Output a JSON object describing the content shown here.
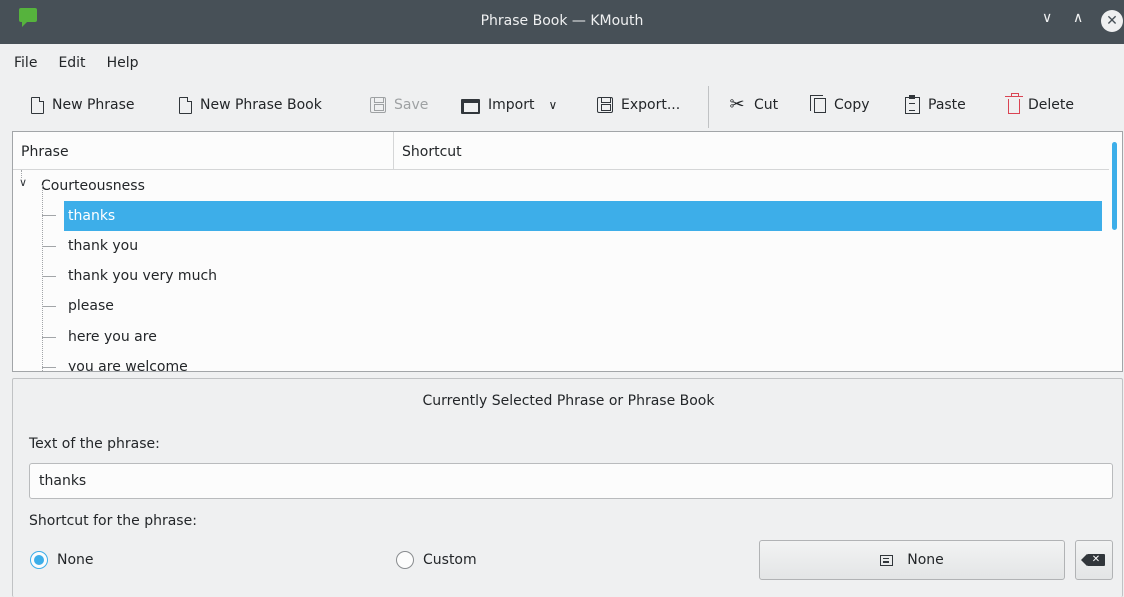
{
  "window": {
    "title": "Phrase Book — KMouth",
    "minimize_glyph": "∨",
    "maximize_glyph": "∧",
    "close_glyph": "✕"
  },
  "menu": [
    {
      "label": "File"
    },
    {
      "label": "Edit"
    },
    {
      "label": "Help"
    }
  ],
  "toolbar": {
    "new_phrase": "New Phrase",
    "new_phrase_book": "New Phrase Book",
    "save": "Save",
    "import": "Import",
    "import_chevron": "∨",
    "export": "Export...",
    "cut": "Cut",
    "cut_glyph": "✂",
    "copy": "Copy",
    "paste": "Paste",
    "delete": "Delete"
  },
  "tree": {
    "columns": [
      "Phrase",
      "Shortcut"
    ],
    "expander_glyph": "∨",
    "root": "Courteousness",
    "items": [
      {
        "phrase": "thanks",
        "shortcut": "",
        "selected": true
      },
      {
        "phrase": "thank you",
        "shortcut": ""
      },
      {
        "phrase": "thank you very much",
        "shortcut": ""
      },
      {
        "phrase": "please",
        "shortcut": ""
      },
      {
        "phrase": "here you are",
        "shortcut": ""
      },
      {
        "phrase": "you are welcome",
        "shortcut": ""
      }
    ]
  },
  "details": {
    "title": "Currently Selected Phrase or Phrase Book",
    "text_label": "Text of the phrase:",
    "text_value": "thanks",
    "shortcut_label": "Shortcut for the phrase:",
    "radio_none": "None",
    "radio_custom": "Custom",
    "shortcut_button": "None"
  },
  "colors": {
    "accent": "#3daee9",
    "titlebar": "#475057",
    "delete": "#da4453"
  }
}
